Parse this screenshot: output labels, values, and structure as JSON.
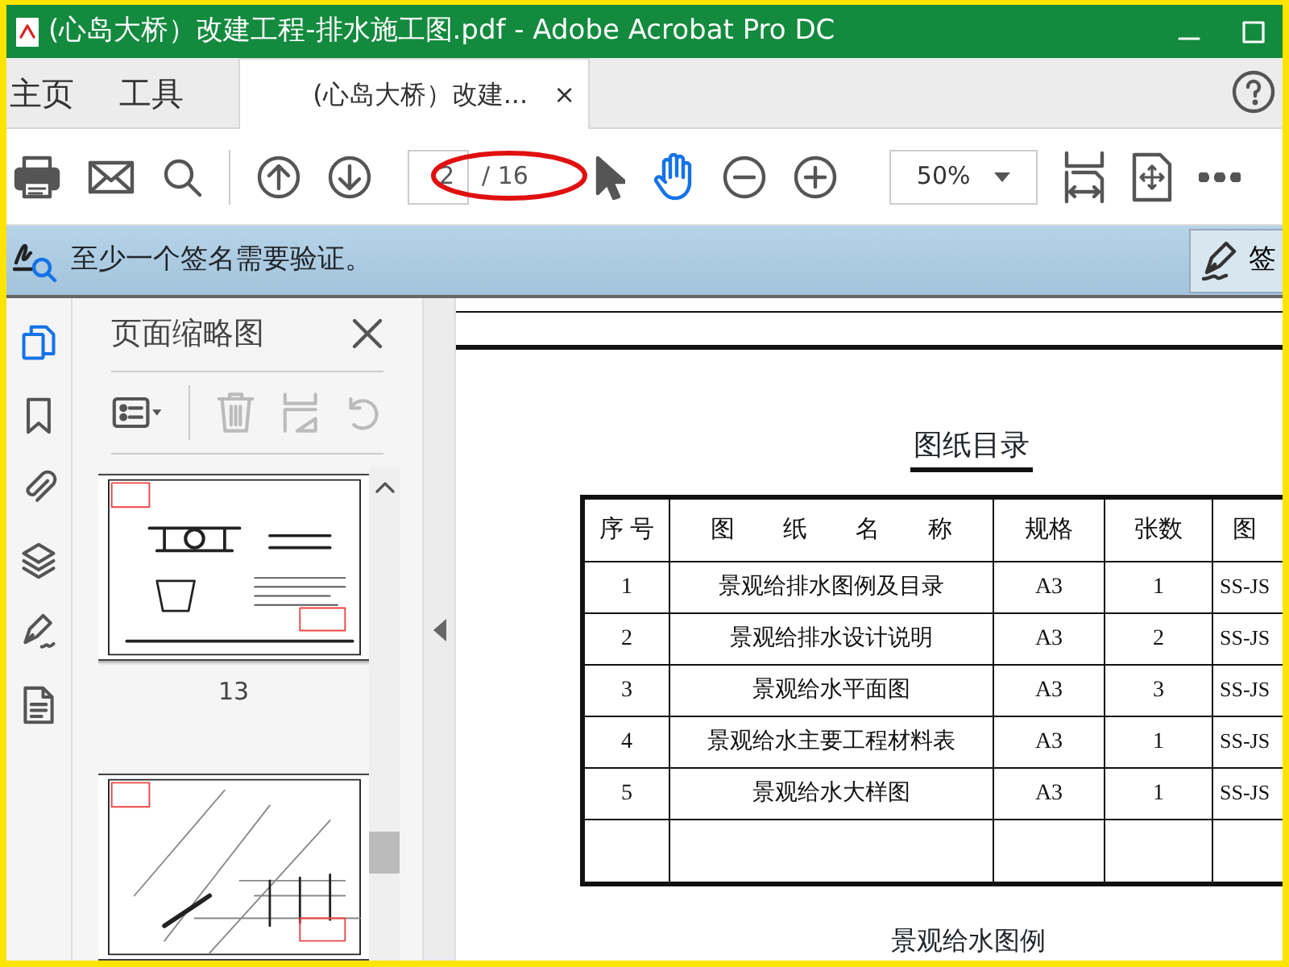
{
  "window": {
    "title": "(心岛大桥）改建工程-排水施工图.pdf - Adobe Acrobat Pro DC"
  },
  "nav_tabs": [
    {
      "label": "主页",
      "selected": false
    },
    {
      "label": "工具",
      "selected": false
    }
  ],
  "doc_tab": {
    "label": "(心岛大桥）改建...",
    "close": "×",
    "selected": true
  },
  "toolbar": {
    "page_current": "2",
    "page_total": "/ 16",
    "zoom": "50%",
    "tools": [
      {
        "kind": "select",
        "selected": false
      },
      {
        "kind": "hand",
        "selected": true
      }
    ]
  },
  "signature_bar": {
    "message": "至少一个签名需要验证。",
    "button": "签"
  },
  "rail": [
    {
      "kind": "pages",
      "selected": true
    },
    {
      "kind": "bookmarks",
      "selected": false
    },
    {
      "kind": "attachments",
      "selected": false
    },
    {
      "kind": "layers",
      "selected": false
    },
    {
      "kind": "signatures",
      "selected": false
    },
    {
      "kind": "document",
      "selected": false
    }
  ],
  "side_panel": {
    "title": "页面缩略图",
    "thumbnails": [
      {
        "kind": "detail",
        "label": "13"
      },
      {
        "kind": "plan"
      }
    ]
  },
  "document": {
    "heading": "图纸目录",
    "columns": [
      "序 号",
      "图　　纸　　名　　称",
      "规格",
      "张数",
      "图"
    ],
    "rows": [
      [
        "1",
        "景观给排水图例及目录",
        "A3",
        "1",
        "SS-JS"
      ],
      [
        "2",
        "景观给排水设计说明",
        "A3",
        "2",
        "SS-JS"
      ],
      [
        "3",
        "景观给水平面图",
        "A3",
        "3",
        "SS-JS"
      ],
      [
        "4",
        "景观给水主要工程材料表",
        "A3",
        "1",
        "SS-JS"
      ],
      [
        "5",
        "景观给水大样图",
        "A3",
        "1",
        "SS-JS"
      ]
    ],
    "footer_text": "景观给水图例"
  }
}
